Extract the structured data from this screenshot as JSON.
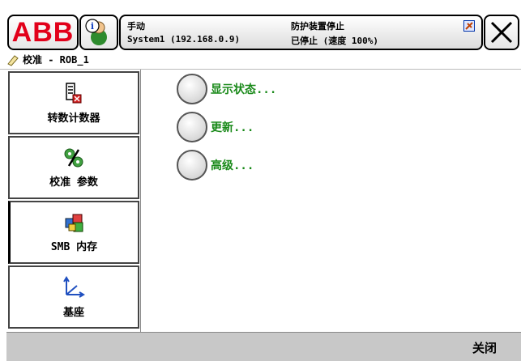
{
  "header": {
    "brand": "ABB",
    "mode": "手动",
    "system": "System1 (192.168.0.9)",
    "guard_status": "防护装置停止",
    "run_state": "已停止 (速度 100%)"
  },
  "title": {
    "text": "校准 - ROB_1"
  },
  "nav": {
    "items": [
      {
        "label": "转数计数器",
        "icon": "rev-counter-icon"
      },
      {
        "label": "校准 参数",
        "icon": "calibration-params-icon"
      },
      {
        "label": "SMB 内存",
        "icon": "smb-memory-icon"
      },
      {
        "label": "基座",
        "icon": "base-frame-icon"
      }
    ]
  },
  "options": [
    {
      "label": "显示状态..."
    },
    {
      "label": "更新..."
    },
    {
      "label": "高级..."
    }
  ],
  "footer": {
    "close_label": "关闭"
  },
  "colors": {
    "brand_red": "#e2001a",
    "option_green": "#1a8a1a",
    "footer_gray": "#c8c8c8"
  }
}
